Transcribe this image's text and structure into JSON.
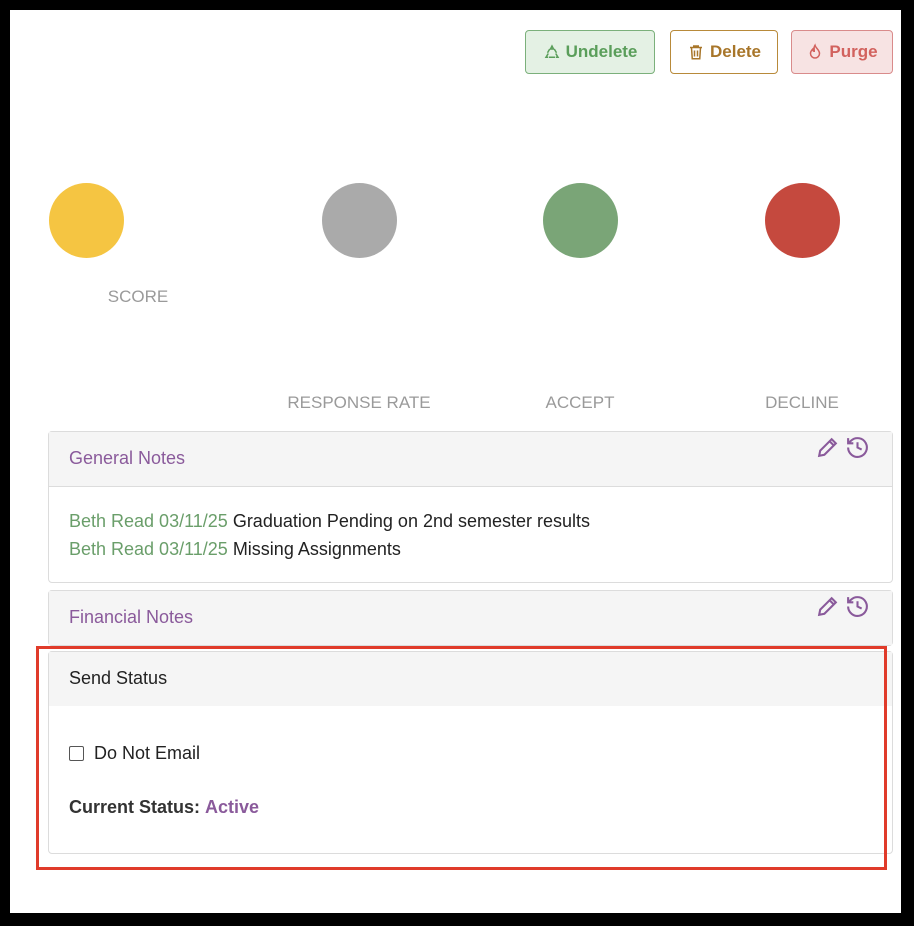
{
  "toolbar": {
    "undelete_label": "Undelete",
    "delete_label": "Delete",
    "purge_label": "Purge",
    "undelete_icon": "recycle-icon",
    "delete_icon": "trash-icon",
    "purge_icon": "fire-icon"
  },
  "metrics": [
    {
      "label": "SCORE",
      "color": "#f5c542"
    },
    {
      "label": "RESPONSE RATE",
      "color": "#aaaaaa"
    },
    {
      "label": "ACCEPT",
      "color": "#7aa577"
    },
    {
      "label": "DECLINE",
      "color": "#c5493e"
    }
  ],
  "general_notes": {
    "title": "General Notes",
    "notes": [
      {
        "author": "Beth Read 03/11/25",
        "text": "Graduation Pending on 2nd semester results"
      },
      {
        "author": "Beth Read 03/11/25",
        "text": "Missing Assignments"
      }
    ]
  },
  "financial_notes": {
    "title": "Financial Notes"
  },
  "send_status": {
    "title": "Send Status",
    "do_not_email_label": "Do Not Email",
    "do_not_email_checked": false,
    "current_status_label": "Current Status:",
    "current_status_value": "Active"
  },
  "colors": {
    "accent_purple": "#8a5a9b",
    "highlight_red": "#e03b2a"
  }
}
